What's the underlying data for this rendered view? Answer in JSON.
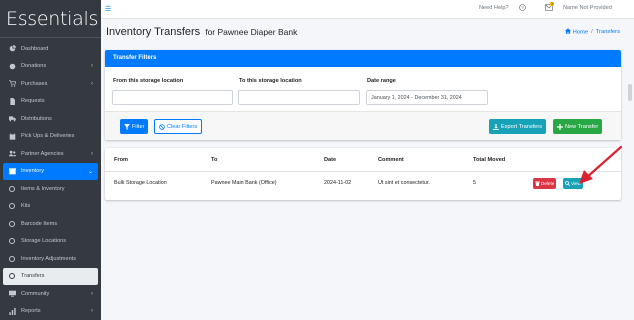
{
  "brand": "Essentials",
  "sidebar": {
    "items": [
      {
        "label": "Dashboard",
        "icon": "dashboard-icon"
      },
      {
        "label": "Donations",
        "icon": "donations-icon",
        "chevron": "‹"
      },
      {
        "label": "Purchases",
        "icon": "cart-icon",
        "chevron": "‹"
      },
      {
        "label": "Requests",
        "icon": "file-icon"
      },
      {
        "label": "Distributions",
        "icon": "truck-icon"
      },
      {
        "label": "Pick Ups & Deliveries",
        "icon": "calendar-icon"
      },
      {
        "label": "Partner Agencies",
        "icon": "partners-icon",
        "chevron": "‹"
      },
      {
        "label": "Inventory",
        "icon": "inventory-icon",
        "chevron": "⌄"
      },
      {
        "label": "Items & Inventory"
      },
      {
        "label": "Kits"
      },
      {
        "label": "Barcode Items"
      },
      {
        "label": "Storage Locations"
      },
      {
        "label": "Inventory Adjustments"
      },
      {
        "label": "Transfers"
      },
      {
        "label": "Community",
        "icon": "community-icon",
        "chevron": "‹"
      },
      {
        "label": "Reports",
        "icon": "reports-icon",
        "chevron": "‹"
      }
    ]
  },
  "topbar": {
    "help": "Need Help?",
    "badge": "3",
    "user": "Name Not Provided"
  },
  "page": {
    "title": "Inventory Transfers",
    "subtitle": "for Pawnee Diaper Bank",
    "breadcrumb_home": "Home",
    "breadcrumb_sep": "/",
    "breadcrumb_current": "Transfers"
  },
  "filters": {
    "header": "Transfer Filters",
    "from_label": "From this storage location",
    "from_value": "",
    "to_label": "To this storage location",
    "to_value": "",
    "date_label": "Date range",
    "date_value": "January 1, 2024 - December 31, 2024",
    "filter_btn": "Filter",
    "clear_btn": "Clear Filters",
    "export_btn": "Export Transfers",
    "new_btn": "New Transfer"
  },
  "table": {
    "headers": [
      "From",
      "To",
      "Date",
      "Comment",
      "Total Moved"
    ],
    "rows": [
      {
        "from": "Bulk Storage Location",
        "to": "Pawnee Main Bank (Office)",
        "date": "2024-11-02",
        "comment": "Ut sint et consectetur.",
        "total": "5",
        "delete": "Delete",
        "view": "View"
      }
    ]
  },
  "colors": {
    "sidebar": "#343a40",
    "primary": "#007bff",
    "info": "#17a2b8",
    "success": "#28a745",
    "danger": "#dc3545",
    "annotation_arrow": "#d9232f"
  }
}
